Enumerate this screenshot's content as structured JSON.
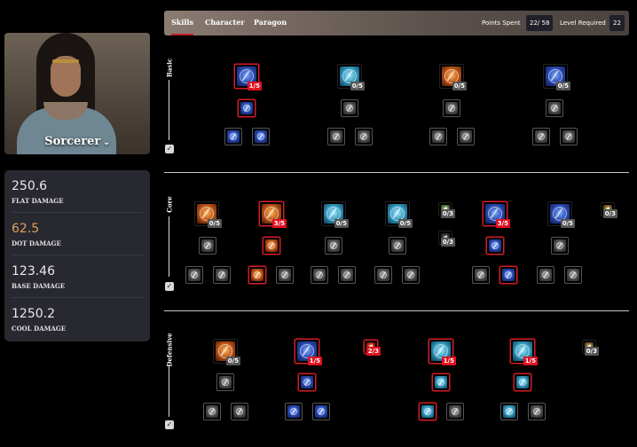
{
  "character": {
    "class_name": "Sorcerer",
    "stats": [
      {
        "value": "250.6",
        "label": "FLAT DAMAGE",
        "color": "#e8e8e8"
      },
      {
        "value": "62.5",
        "label": "DOT DAMAGE",
        "color": "#e0a257"
      },
      {
        "value": "123.46",
        "label": "BASE DAMAGE",
        "color": "#e8e8e8"
      },
      {
        "value": "1250.2",
        "label": "COOL DAMAGE",
        "color": "#e8e8e8"
      }
    ]
  },
  "topbar": {
    "tabs": [
      {
        "label": "Skills",
        "active": true
      },
      {
        "label": "Character",
        "active": false
      },
      {
        "label": "Paragon",
        "active": false
      }
    ],
    "points_spent_label": "Points Spent",
    "points_spent_value": "22/ 58",
    "level_required_label": "Level Required",
    "level_required_value": "22"
  },
  "sections": {
    "basic": {
      "label": "Basic",
      "ranks": [
        "1/5",
        "0/5",
        "0/5",
        "0/5"
      ]
    },
    "core": {
      "label": "Core",
      "ranks": [
        "0/5",
        "3/5",
        "0/5",
        "0/5",
        "0/3",
        "3/5",
        "0/5",
        "0/3",
        "0/3"
      ]
    },
    "defensive": {
      "label": "Defensive",
      "ranks": [
        "0/5",
        "1/5",
        "2/3",
        "1/5",
        "1/5",
        "0/3"
      ]
    }
  },
  "colors": {
    "accent_red": "#e01020",
    "highlight_stat": "#e0a257",
    "panel_bg": "#282830"
  }
}
